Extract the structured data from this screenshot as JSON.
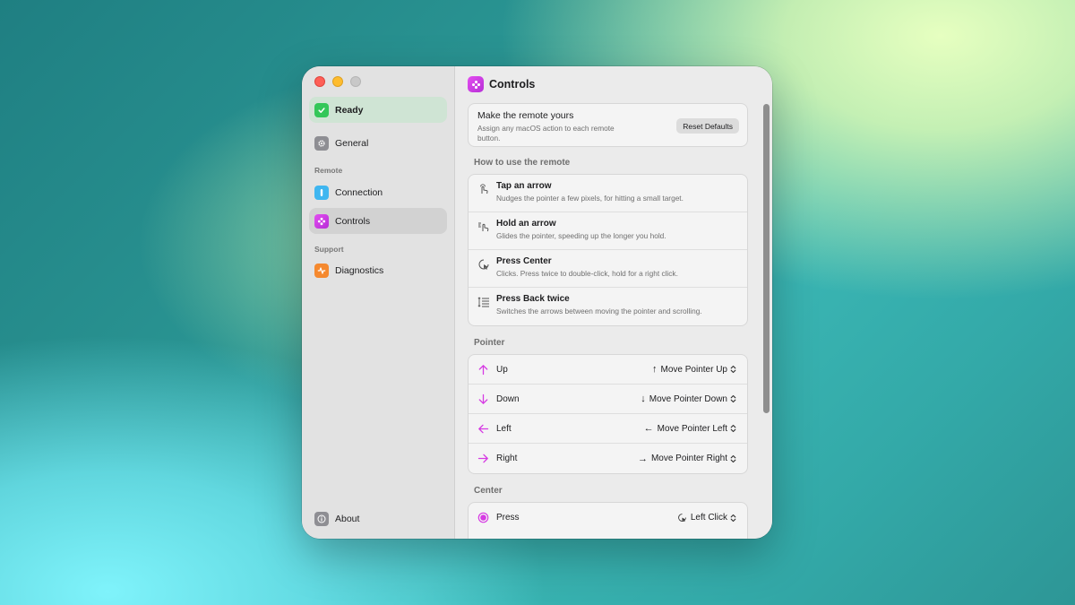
{
  "sidebar": {
    "status": "Ready",
    "general": "General",
    "section_remote": "Remote",
    "connection": "Connection",
    "controls": "Controls",
    "section_support": "Support",
    "diagnostics": "Diagnostics",
    "about": "About"
  },
  "main": {
    "title": "Controls",
    "intro": {
      "title": "Make the remote yours",
      "subtitle": "Assign any macOS action to each remote button.",
      "reset_button": "Reset Defaults"
    },
    "how_section": "How to use the remote",
    "how_items": [
      {
        "title": "Tap an arrow",
        "subtitle": "Nudges the pointer a few pixels, for hitting a small target."
      },
      {
        "title": "Hold an arrow",
        "subtitle": "Glides the pointer, speeding up the longer you hold."
      },
      {
        "title": "Press Center",
        "subtitle": "Clicks. Press twice to double-click, hold for a right click."
      },
      {
        "title": "Press Back twice",
        "subtitle": "Switches the arrows between moving the pointer and scrolling."
      }
    ],
    "pointer_section": "Pointer",
    "pointer_items": [
      {
        "label": "Up",
        "glyph": "↑",
        "value": "Move Pointer Up"
      },
      {
        "label": "Down",
        "glyph": "↓",
        "value": "Move Pointer Down"
      },
      {
        "label": "Left",
        "glyph": "←",
        "value": "Move Pointer Left"
      },
      {
        "label": "Right",
        "glyph": "→",
        "value": "Move Pointer Right"
      }
    ],
    "center_section": "Center",
    "center_items": [
      {
        "label": "Press",
        "value": "Left Click"
      }
    ]
  },
  "colors": {
    "accent": "#d63be3",
    "ready_green": "#34c759",
    "diagnostics_orange": "#f5892f",
    "connection_blue": "#3fb6f0"
  }
}
